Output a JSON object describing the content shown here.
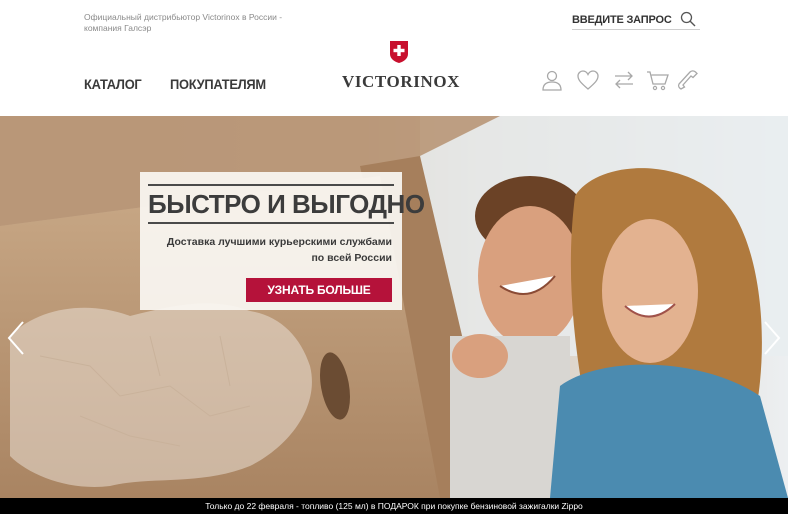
{
  "header": {
    "distributor_text": "Официальный дистрибьютор Victorinox в России - компания Галсэр",
    "search": {
      "placeholder": "ВВЕДИТЕ ЗАПРОС",
      "icon": "search-icon"
    },
    "nav": [
      {
        "label": "КАТАЛОГ"
      },
      {
        "label": "ПОКУПАТЕЛЯМ"
      }
    ],
    "logo": {
      "wordmark": "VICTORINOX",
      "emblem": "swiss-cross-shield",
      "brand_color": "#c8102e"
    },
    "icons": [
      "user-icon",
      "heart-icon",
      "compare-icon",
      "cart-icon",
      "phone-icon"
    ]
  },
  "hero": {
    "title": "БЫСТРО И ВЫГОДНО",
    "text": "Доставка лучшими курьерскими службами по всей России",
    "button_label": "УЗНАТЬ БОЛЬШЕ",
    "button_color": "#b5123a",
    "prev_icon": "chevron-left-icon",
    "next_icon": "chevron-right-icon"
  },
  "bottom_bar": {
    "text": "Только до 22 февраля - топливо (125 мл) в ПОДАРОК при покупке бензиновой зажигалки Zippo"
  }
}
